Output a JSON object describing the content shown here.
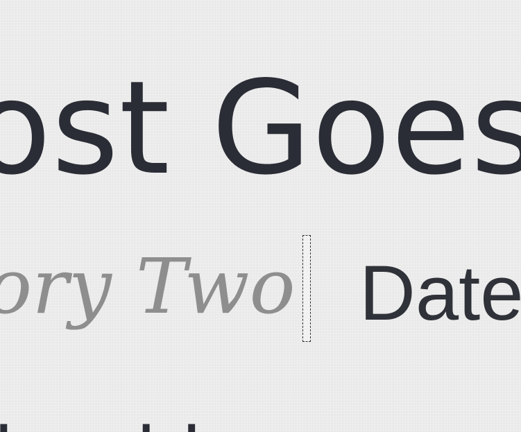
{
  "post": {
    "title": "ost Goes",
    "category": "ory Two",
    "date": "Date",
    "excerpt": "l ... l l"
  }
}
